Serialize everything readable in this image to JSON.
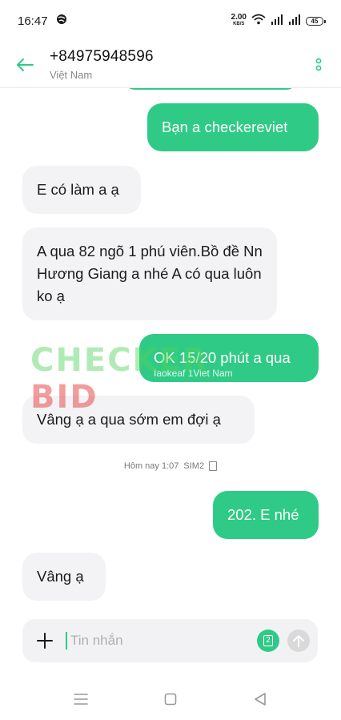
{
  "status_bar": {
    "time": "16:47",
    "net_speed_value": "2.00",
    "net_speed_unit": "KB/S",
    "battery": "45"
  },
  "header": {
    "contact_number": "+84975948596",
    "contact_country": "Việt Nam"
  },
  "messages": [
    {
      "direction": "out",
      "text": "Bạn a checkereviet"
    },
    {
      "direction": "in",
      "text": "E có làm a ạ"
    },
    {
      "direction": "in",
      "text": "A qua 82 ngõ 1 phú viên.Bồ đề Nn Hương Giang a nhé A có qua luôn ko ạ"
    },
    {
      "direction": "out",
      "text": "OK 15/20 phút a qua",
      "subtext": "Iaokeaf 1Viet Nam"
    },
    {
      "direction": "in",
      "text": "Vâng ạ a qua sớm em đợi ạ"
    },
    {
      "direction": "out",
      "text": "202. E nhé"
    },
    {
      "direction": "in",
      "text": "Vâng ạ"
    }
  ],
  "timestamp": {
    "text": "Hôm nay 1:07",
    "sim": "SIM2"
  },
  "watermark": {
    "main": "CHECKER",
    "tail": "BID"
  },
  "composer": {
    "placeholder": "Tin nhắn",
    "sim_label": "2"
  },
  "colors": {
    "accent": "#2fcb86",
    "incoming_bubble": "#f3f3f5",
    "composer_bg": "#f2f2f4"
  }
}
